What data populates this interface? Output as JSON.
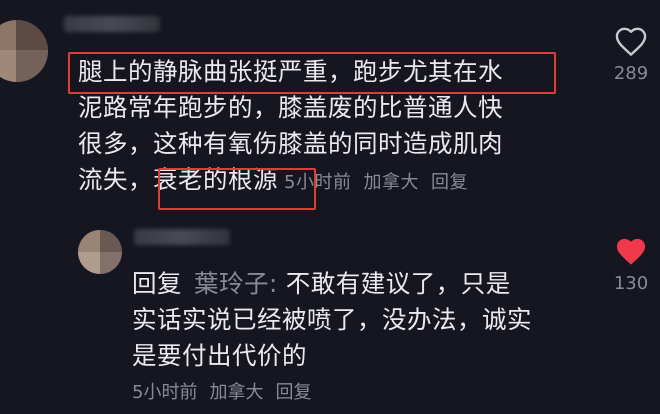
{
  "comment1": {
    "lines": [
      "腿上的静脉曲张挺严重，跑步尤其在水",
      "泥路常年跑步的，膝盖废的比普通人快",
      "很多，这种有氧伤膝盖的同时造成肌肉",
      "流失，衰老的根源"
    ],
    "timestamp": "5小时前",
    "location": "加拿大",
    "reply_label": "回复",
    "like_count": "289",
    "like_icon": "heart-outline-icon"
  },
  "comment2": {
    "reply_prefix": "回复",
    "reply_to": "葉玲子:",
    "lines": [
      "不敢有建议了，只是",
      "实话实说已经被喷了，没办法，诚实",
      "是要付出代价的"
    ],
    "timestamp": "5小时前",
    "location": "加拿大",
    "reply_label": "回复",
    "like_count": "130",
    "like_icon": "heart-filled-icon",
    "like_color": "#f0394a"
  }
}
